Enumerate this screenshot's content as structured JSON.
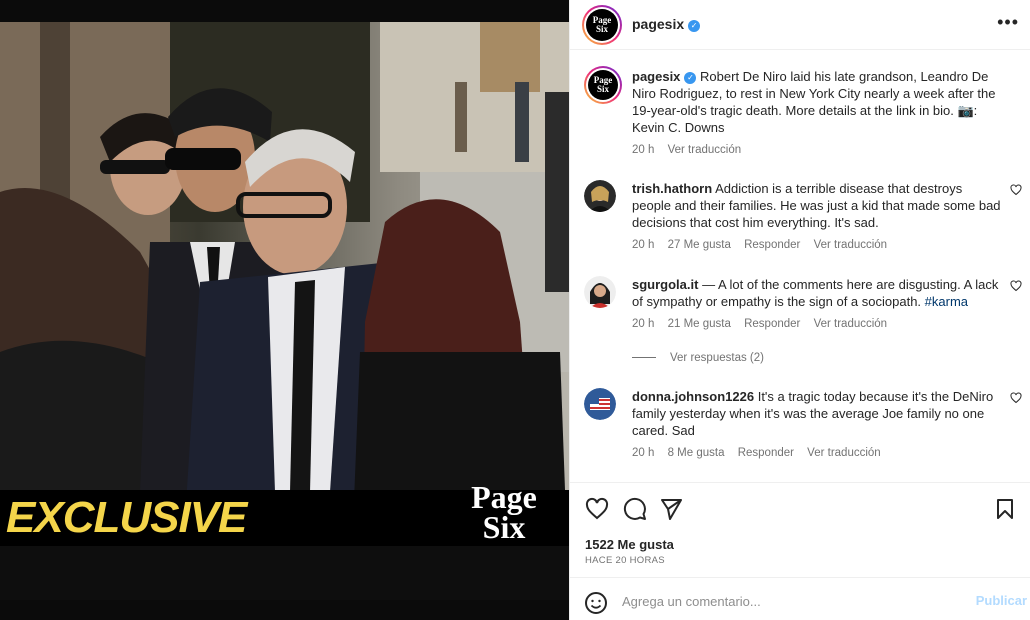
{
  "post": {
    "author": "pagesix",
    "avatar_logo_line1": "Page",
    "avatar_logo_line2": "Six",
    "caption": "Robert De Niro laid his late grandson, Leandro De Niro Rodriguez, to rest in New York City nearly a week after the 19-year-old's tragic death. More details at the link in bio. 📷: Kevin C. Downs",
    "caption_time": "20 h",
    "caption_translate": "Ver traducción",
    "likes": "1522 Me gusta",
    "posted_ago": "HACE 20 HORAS"
  },
  "media": {
    "banner_text": "EXCLUSIVE",
    "logo_line1": "Page",
    "logo_line2": "Six"
  },
  "comments": [
    {
      "user": "trish.hathorn",
      "text": "Addiction is a terrible disease that destroys people and their families. He was just a kid that made some bad decisions that cost him everything. It's sad.",
      "time": "20 h",
      "likes": "27 Me gusta",
      "reply": "Responder",
      "translate": "Ver traducción"
    },
    {
      "user": "sgurgola.it",
      "text": "— A lot of the comments here are disgusting. A lack of sympathy or empathy is the sign of a sociopath. ",
      "hashtag": "#karma",
      "time": "20 h",
      "likes": "21 Me gusta",
      "reply": "Responder",
      "translate": "Ver traducción"
    },
    {
      "user": "donna.johnson1226",
      "text": "It's a tragic today because it's the DeNiro family yesterday when it's was the average Joe family no one cared. Sad",
      "time": "20 h",
      "likes": "8 Me gusta",
      "reply": "Responder",
      "translate": "Ver traducción"
    }
  ],
  "replies_toggle": "Ver respuestas (2)",
  "composer": {
    "placeholder": "Agrega un comentario...",
    "post_label": "Publicar"
  },
  "icons": {
    "more": "more-options-icon",
    "like": "heart-icon",
    "comment": "comment-icon",
    "share": "send-icon",
    "save": "bookmark-icon",
    "emoji": "emoji-icon"
  },
  "colors": {
    "verified": "#3897f0",
    "banner_text": "#f4d54a",
    "post_button_disabled": "#b3dbff",
    "hashtag": "#00376b"
  }
}
